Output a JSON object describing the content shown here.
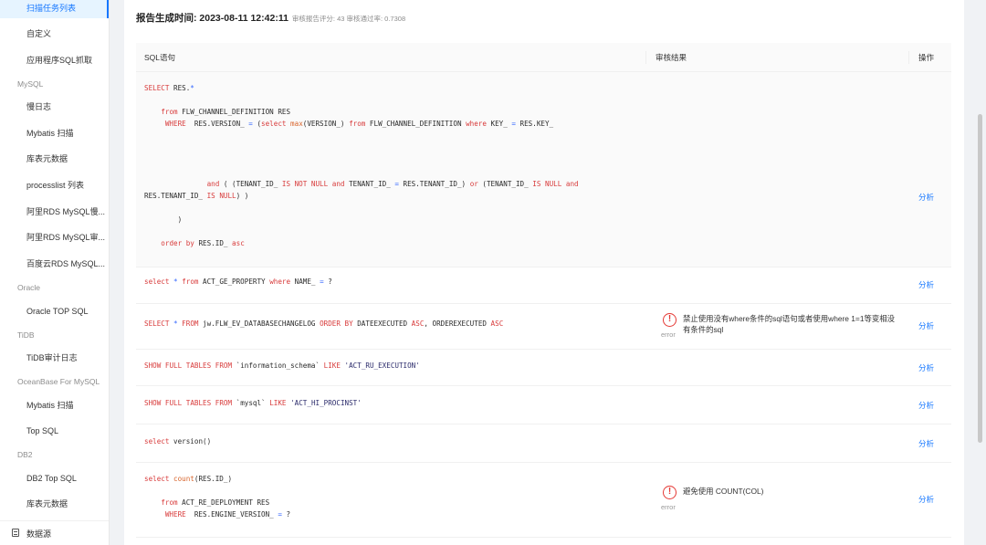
{
  "sidebar": {
    "items": [
      {
        "label": "扫描任务列表",
        "type": "item",
        "active": true
      },
      {
        "label": "自定义",
        "type": "item"
      },
      {
        "label": "应用程序SQL抓取",
        "type": "item"
      },
      {
        "label": "MySQL",
        "type": "group"
      },
      {
        "label": "慢日志",
        "type": "item"
      },
      {
        "label": "Mybatis 扫描",
        "type": "item"
      },
      {
        "label": "库表元数据",
        "type": "item"
      },
      {
        "label": "processlist 列表",
        "type": "item"
      },
      {
        "label": "阿里RDS MySQL慢...",
        "type": "item"
      },
      {
        "label": "阿里RDS MySQL审...",
        "type": "item"
      },
      {
        "label": "百度云RDS MySQL...",
        "type": "item"
      },
      {
        "label": "Oracle",
        "type": "group"
      },
      {
        "label": "Oracle TOP SQL",
        "type": "item"
      },
      {
        "label": "TiDB",
        "type": "group"
      },
      {
        "label": "TiDB审计日志",
        "type": "item"
      },
      {
        "label": "OceanBase For MySQL",
        "type": "group"
      },
      {
        "label": "Mybatis 扫描",
        "type": "item"
      },
      {
        "label": "Top SQL",
        "type": "item"
      },
      {
        "label": "DB2",
        "type": "group"
      },
      {
        "label": "DB2 Top SQL",
        "type": "item"
      },
      {
        "label": "库表元数据",
        "type": "item"
      }
    ],
    "bottom": {
      "label": "数据源",
      "icon": "database-icon"
    }
  },
  "report": {
    "title": "报告生成时间: 2023-08-11 12:42:11",
    "meta": "审核报告评分: 43 审核通过率: 0.7308"
  },
  "table": {
    "headers": {
      "sql": "SQL语句",
      "result": "审核结果",
      "action": "操作"
    },
    "action_label": "分析",
    "error_label": "error",
    "rows": [
      {
        "sql": [
          "SELECT RES.*",
          "",
          "    from FLW_CHANNEL_DEFINITION RES",
          "     WHERE  RES.VERSION_ = (select max(VERSION_) from FLW_CHANNEL_DEFINITION where KEY_ = RES.KEY_",
          "",
          "",
          "",
          "",
          "               and ( (TENANT_ID_ IS NOT NULL and TENANT_ID_ = RES.TENANT_ID_) or (TENANT_ID_ IS NULL and",
          "RES.TENANT_ID_ IS NULL) )",
          "",
          "        )",
          "",
          "    order by RES.ID_ asc"
        ],
        "error": null
      },
      {
        "sql": [
          "select * from ACT_GE_PROPERTY where NAME_ = ?"
        ],
        "error": null
      },
      {
        "sql": [
          "SELECT * FROM jw.FLW_EV_DATABASECHANGELOG ORDER BY DATEEXECUTED ASC, ORDEREXECUTED ASC"
        ],
        "error": "禁止使用没有where条件的sql语句或者使用where 1=1等变相没有条件的sql"
      },
      {
        "sql": [
          "SHOW FULL TABLES FROM `information_schema` LIKE 'ACT_RU_EXECUTION'"
        ],
        "error": null
      },
      {
        "sql": [
          "SHOW FULL TABLES FROM `mysql` LIKE 'ACT_HI_PROCINST'"
        ],
        "error": null
      },
      {
        "sql": [
          "select version()"
        ],
        "error": null
      },
      {
        "sql": [
          "select count(RES.ID_)",
          "",
          "    from ACT_RE_DEPLOYMENT RES",
          "     WHERE  RES.ENGINE_VERSION_ = ?"
        ],
        "error": "避免使用 COUNT(COL)"
      }
    ]
  },
  "colors": {
    "accent": "#1677ff",
    "keyword": "#d83b3b",
    "error": "#e53935",
    "active_bg": "#e6f4ff"
  }
}
